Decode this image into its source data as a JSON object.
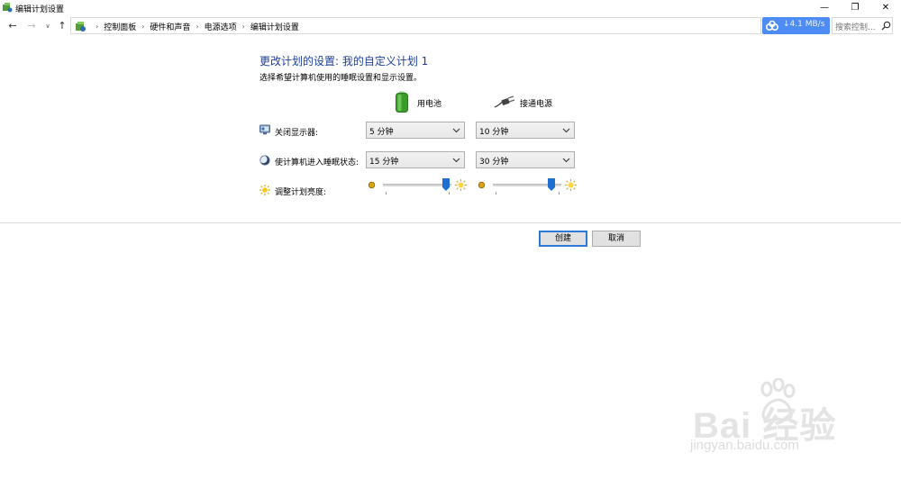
{
  "window": {
    "title": "编辑计划设置",
    "controls": {
      "minimize": "—",
      "maximize": "❐",
      "close": "✕"
    }
  },
  "nav": {
    "back": "←",
    "forward": "→",
    "history": "∨",
    "up": "↑",
    "breadcrumbs": [
      "控制面板",
      "硬件和声音",
      "电源选项",
      "编辑计划设置"
    ],
    "separator": "›",
    "netspeed": "4.1 MB/s",
    "netspeed_arrow": "↓",
    "search_placeholder": "搜索控制..."
  },
  "content": {
    "heading": "更改计划的设置: 我的自定义计划 1",
    "subtitle": "选择希望计算机使用的睡眠设置和显示设置。",
    "columns": {
      "battery": "用电池",
      "plugged": "接通电源"
    },
    "rows": {
      "display_off": {
        "label": "关闭显示器:",
        "battery": "5 分钟",
        "plugged": "10 分钟"
      },
      "sleep": {
        "label": "使计算机进入睡眠状态:",
        "battery": "15 分钟",
        "plugged": "30 分钟"
      },
      "brightness": {
        "label": "调整计划亮度:",
        "battery_level": 0.92,
        "plugged_level": 0.85
      }
    }
  },
  "buttons": {
    "create": "创建",
    "cancel": "取消"
  },
  "watermark": {
    "text": "Bai  经验",
    "url": "jingyan.baidu.com"
  },
  "colors": {
    "heading": "#1e3f99",
    "accent": "#2a7ad6",
    "netspeed_bg": "#4d8cf5",
    "thumb": "#1f6fd0"
  }
}
